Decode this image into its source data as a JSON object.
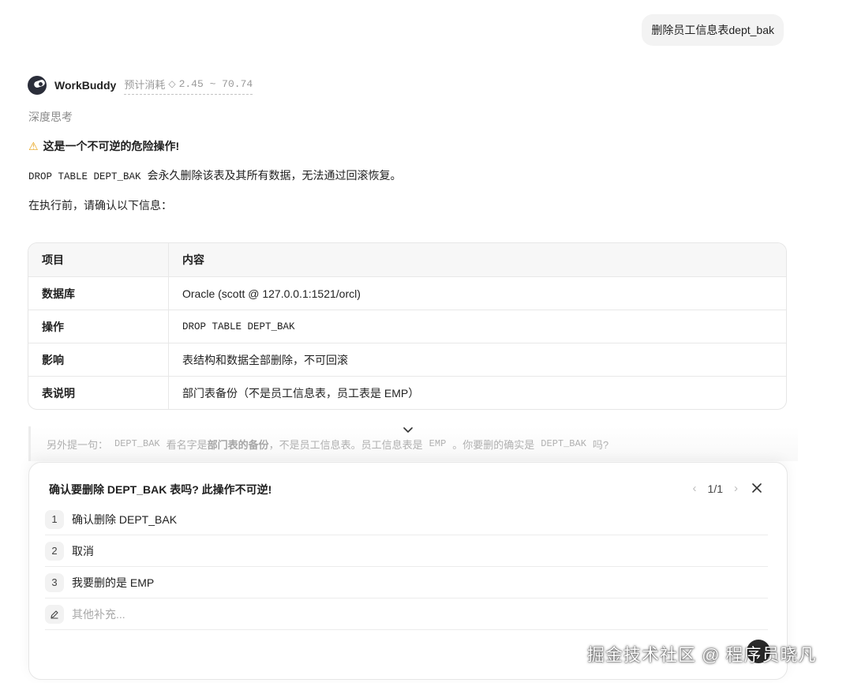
{
  "user_message": "删除员工信息表dept_bak",
  "assistant": {
    "name": "WorkBuddy",
    "cost_label": "预计消耗",
    "cost_range": "2.45 ~ 70.74",
    "thinking_label": "深度思考"
  },
  "response": {
    "warning_title": "这是一个不可逆的危险操作!",
    "para1_code": "DROP TABLE DEPT_BAK",
    "para1_text": "会永久删除该表及其所有数据，无法通过回滚恢复。",
    "para2": "在执行前，请确认以下信息："
  },
  "table": {
    "header": {
      "key": "项目",
      "value": "内容"
    },
    "rows": [
      {
        "key": "数据库",
        "value": "Oracle (scott @ 127.0.0.1:1521/orcl)"
      },
      {
        "key": "操作",
        "value": "DROP TABLE DEPT_BAK"
      },
      {
        "key": "影响",
        "value": "表结构和数据全部删除，不可回滚"
      },
      {
        "key": "表说明",
        "value": "部门表备份（不是员工信息表，员工表是 EMP）"
      }
    ]
  },
  "note": {
    "prefix": "另外提一句：",
    "code1": "DEPT_BAK",
    "mid1": "看名字是",
    "bold": "部门表的备份",
    "mid2": "，不是员工信息表。员工信息表是",
    "code2": "EMP",
    "mid3": "。你要删的确实是",
    "code3": "DEPT_BAK",
    "suffix": "吗?"
  },
  "panel": {
    "title": "确认要删除 DEPT_BAK 表吗? 此操作不可逆!",
    "pager": "1/1",
    "options": [
      {
        "num": "1",
        "label": "确认删除 DEPT_BAK"
      },
      {
        "num": "2",
        "label": "取消"
      },
      {
        "num": "3",
        "label": "我要删的是 EMP"
      }
    ],
    "custom_placeholder": "其他补充..."
  },
  "watermark": "掘金技术社区 @ 程序员晓凡",
  "icons": {
    "avatar": "workbuddy-avatar",
    "cost": "diamond-icon",
    "warning": "warning-icon",
    "scroll": "chevron-down-icon",
    "prev": "chevron-left-icon",
    "next": "chevron-right-icon",
    "close": "close-icon",
    "custom": "pencil-icon"
  }
}
